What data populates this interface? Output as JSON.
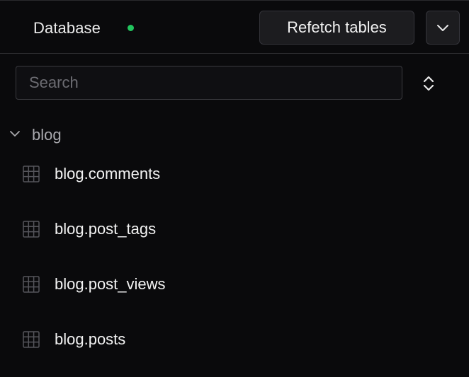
{
  "header": {
    "title": "Database",
    "status_color": "#22c55e",
    "refetch_label": "Refetch tables",
    "menu_icon": "chevron-down-icon"
  },
  "search": {
    "placeholder": "Search",
    "value": "",
    "sort_icon": "chevrons-up-down-icon"
  },
  "schemas": [
    {
      "name": "blog",
      "expanded": true,
      "tables": [
        "blog.comments",
        "blog.post_tags",
        "blog.post_views",
        "blog.posts"
      ]
    }
  ]
}
